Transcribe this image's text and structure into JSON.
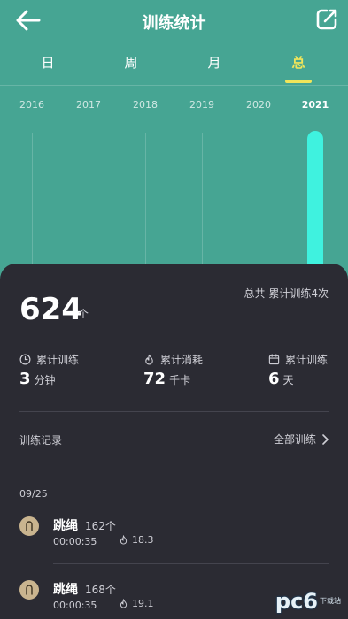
{
  "header": {
    "title": "训练统计"
  },
  "tabs": [
    {
      "label": "日"
    },
    {
      "label": "周"
    },
    {
      "label": "月"
    },
    {
      "label": "总"
    }
  ],
  "active_tab": "总",
  "years": [
    "2016",
    "2017",
    "2018",
    "2019",
    "2020",
    "2021"
  ],
  "active_year": "2021",
  "summary": {
    "count": "624",
    "unit": "个",
    "total": "总共  累计训练4次"
  },
  "stats": [
    {
      "label": "累计训练",
      "value": "3",
      "unit": "分钟",
      "icon": "clock-icon"
    },
    {
      "label": "累计消耗",
      "value": "72",
      "unit": "千卡",
      "icon": "flame-icon"
    },
    {
      "label": "累计训练",
      "value": "6",
      "unit": "天",
      "icon": "calendar-icon"
    }
  ],
  "records": {
    "title": "训练记录",
    "all_link": "全部训练",
    "date": "09/25",
    "items": [
      {
        "name": "跳绳",
        "count": "162个",
        "time": "00:00:35",
        "kcal": "18.3"
      },
      {
        "name": "跳绳",
        "count": "168个",
        "time": "00:00:35",
        "kcal": "19.1"
      }
    ]
  },
  "watermark": {
    "logo": "pc6",
    "sub": "下载站"
  },
  "colors": {
    "background": "#46a593",
    "panel": "#2b2b33",
    "accent": "#f0e55a",
    "bar": "#3ff2df"
  }
}
